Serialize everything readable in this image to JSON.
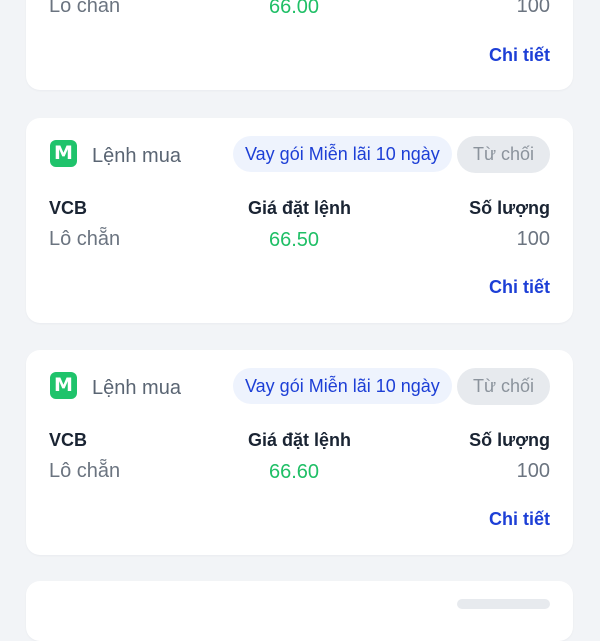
{
  "orders": [
    {
      "lot_type": "Lô chẵn",
      "price": "66.00",
      "quantity": "100",
      "detail_label": "Chi tiết"
    },
    {
      "badge": "M",
      "order_type": "Lệnh mua",
      "loan_tag": "Vay gói Miễn lãi 10 ngày",
      "status": "Từ chối",
      "symbol": "VCB",
      "price_label": "Giá đặt lệnh",
      "quantity_label": "Số lượng",
      "lot_type": "Lô chẵn",
      "price": "66.50",
      "quantity": "100",
      "detail_label": "Chi tiết"
    },
    {
      "badge": "M",
      "order_type": "Lệnh mua",
      "loan_tag": "Vay gói Miễn lãi 10 ngày",
      "status": "Từ chối",
      "symbol": "VCB",
      "price_label": "Giá đặt lệnh",
      "quantity_label": "Số lượng",
      "lot_type": "Lô chẵn",
      "price": "66.60",
      "quantity": "100",
      "detail_label": "Chi tiết"
    }
  ],
  "colors": {
    "background": "#f2f4f7",
    "card": "#ffffff",
    "buy_badge": "#1fc36b",
    "price_green": "#1fbf66",
    "link_blue": "#1d3fd6",
    "status_pill": "#e7eaee"
  }
}
